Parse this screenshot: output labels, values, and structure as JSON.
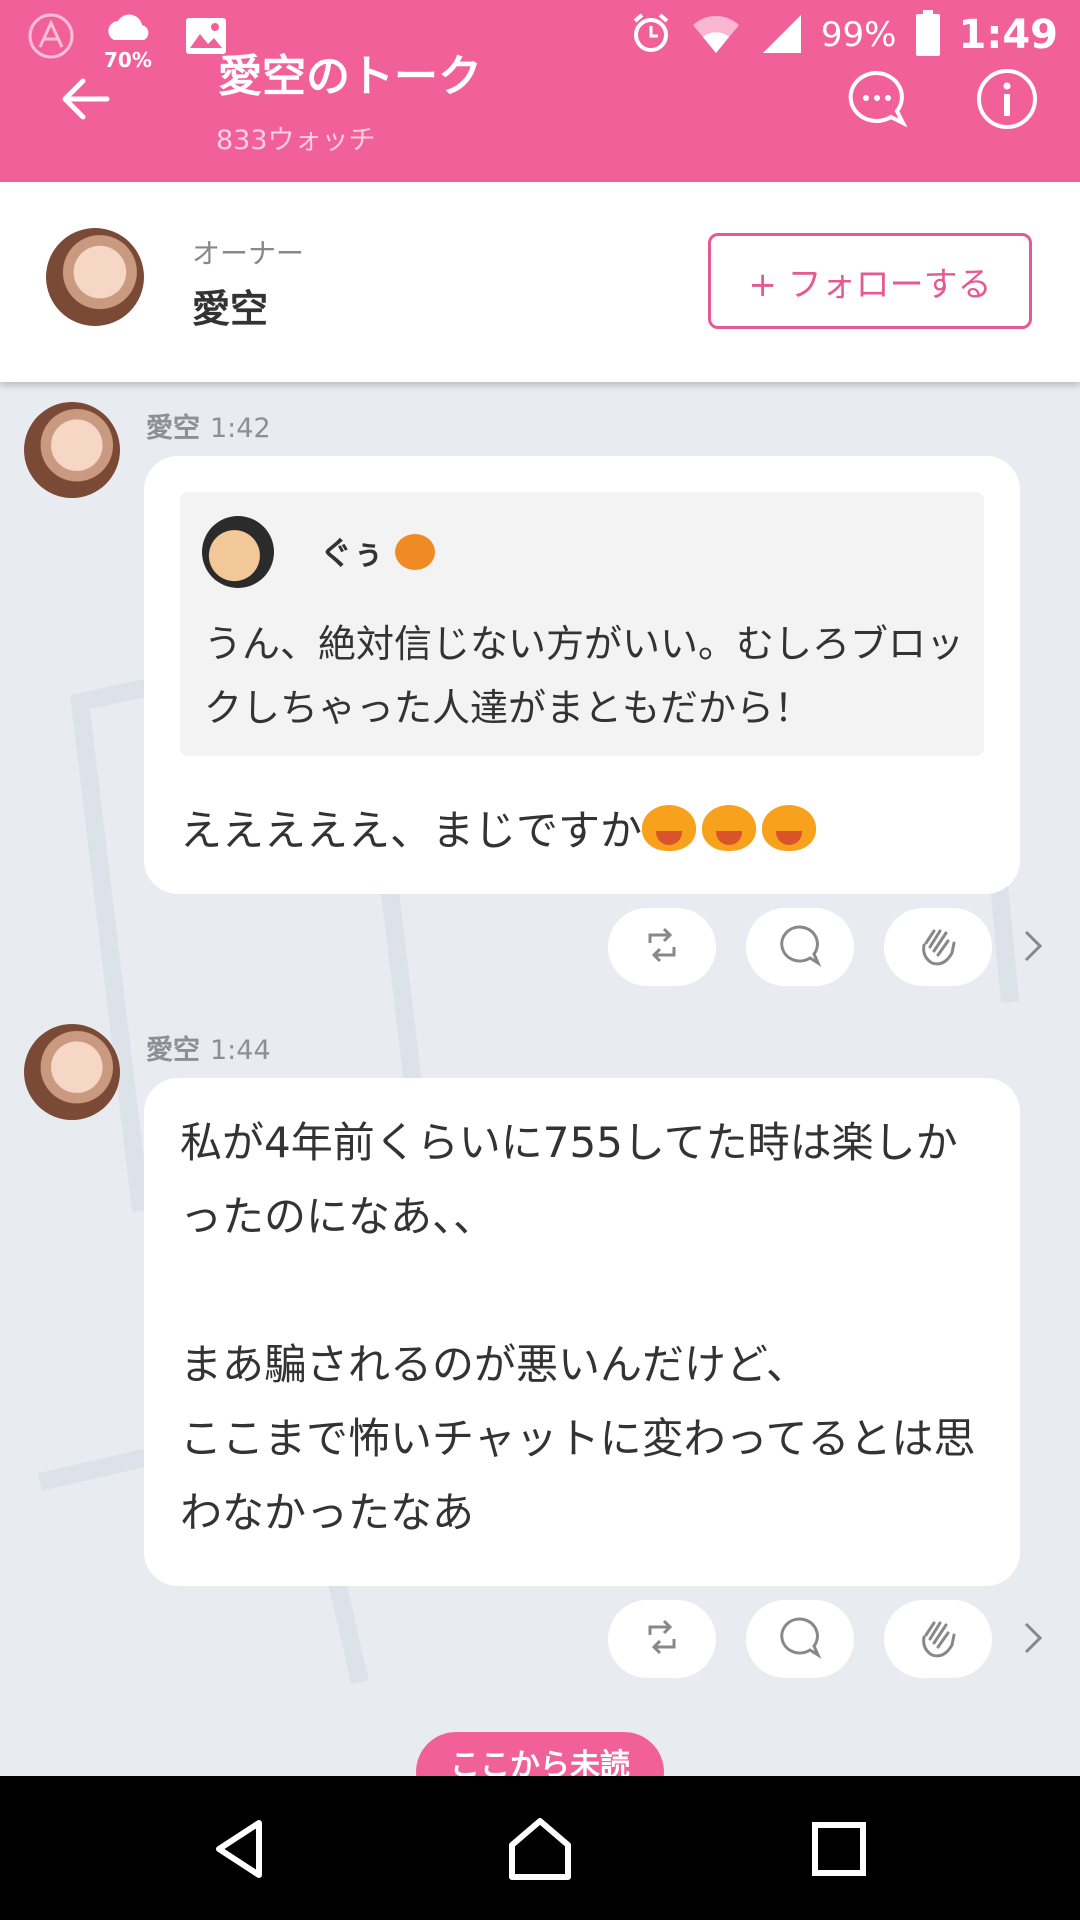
{
  "status": {
    "weather_pct": "70%",
    "battery": "99%",
    "time": "1:49"
  },
  "header": {
    "title": "愛空のトーク",
    "watch_count": "833ウォッチ"
  },
  "owner": {
    "label": "オーナー",
    "name": "愛空",
    "follow_label": "+ フォローする"
  },
  "messages": [
    {
      "author": "愛空",
      "time": "1:42",
      "quote": {
        "author": "ぐぅ",
        "text": "うん、絶対信じない方がいい。むしろブロックしちゃった人達がまともだから！"
      },
      "text": "えええええ、まじですか"
    },
    {
      "author": "愛空",
      "time": "1:44",
      "text": "私が4年前くらいに755してた時は楽しかったのになあ、、\n\nまあ騙されるのが悪いんだけど、\nここまで怖いチャットに変わってるとは思わなかったなあ"
    }
  ],
  "unread_label": "ここから未読",
  "icons": {
    "back": "arrow-left-icon",
    "comments": "chat-bubble-icon",
    "info": "info-icon",
    "repost": "repost-icon",
    "reply": "speech-bubble-icon",
    "clap": "clap-icon",
    "more": "chevron-right-icon"
  },
  "colors": {
    "brand_pink": "#f2609a",
    "follow_pink": "#e55a92",
    "chat_bg": "#e8ebf0"
  }
}
